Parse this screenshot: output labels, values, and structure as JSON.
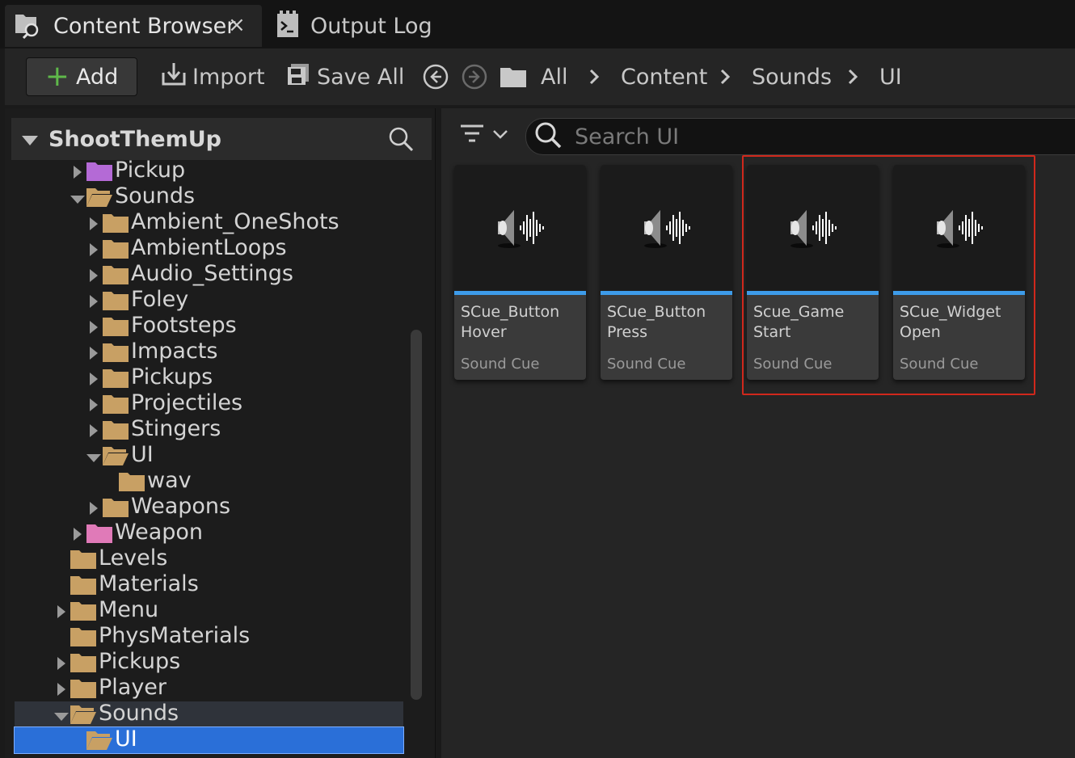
{
  "tabs": {
    "content_browser": "Content Browser",
    "close": "×",
    "output_log": "Output Log"
  },
  "toolbar": {
    "add": "Add",
    "import": "Import",
    "save_all": "Save All"
  },
  "breadcrumb": [
    "All",
    "Content",
    "Sounds",
    "UI"
  ],
  "tree": {
    "root": "ShootThemUp",
    "rows": [
      {
        "label": "Pickup",
        "indent": 4,
        "arrow": "right",
        "color": "#b46ad6",
        "open": false
      },
      {
        "label": "Sounds",
        "indent": 4,
        "arrow": "down",
        "color": "#c8a064",
        "open": true
      },
      {
        "label": "Ambient_OneShots",
        "indent": 5,
        "arrow": "right",
        "color": "#c8a064",
        "open": false
      },
      {
        "label": "AmbientLoops",
        "indent": 5,
        "arrow": "right",
        "color": "#c8a064",
        "open": false
      },
      {
        "label": "Audio_Settings",
        "indent": 5,
        "arrow": "right",
        "color": "#c8a064",
        "open": false
      },
      {
        "label": "Foley",
        "indent": 5,
        "arrow": "right",
        "color": "#c8a064",
        "open": false
      },
      {
        "label": "Footsteps",
        "indent": 5,
        "arrow": "right",
        "color": "#c8a064",
        "open": false
      },
      {
        "label": "Impacts",
        "indent": 5,
        "arrow": "right",
        "color": "#c8a064",
        "open": false
      },
      {
        "label": "Pickups",
        "indent": 5,
        "arrow": "right",
        "color": "#c8a064",
        "open": false
      },
      {
        "label": "Projectiles",
        "indent": 5,
        "arrow": "right",
        "color": "#c8a064",
        "open": false
      },
      {
        "label": "Stingers",
        "indent": 5,
        "arrow": "right",
        "color": "#c8a064",
        "open": false
      },
      {
        "label": "UI",
        "indent": 5,
        "arrow": "down",
        "color": "#c8a064",
        "open": true
      },
      {
        "label": "wav",
        "indent": 6,
        "arrow": "none",
        "color": "#c8a064",
        "open": false
      },
      {
        "label": "Weapons",
        "indent": 5,
        "arrow": "right",
        "color": "#c8a064",
        "open": false
      },
      {
        "label": "Weapon",
        "indent": 4,
        "arrow": "right",
        "color": "#e07ab8",
        "open": false
      },
      {
        "label": "Levels",
        "indent": 3,
        "arrow": "none",
        "color": "#c8a064",
        "open": false
      },
      {
        "label": "Materials",
        "indent": 3,
        "arrow": "none",
        "color": "#c8a064",
        "open": false
      },
      {
        "label": "Menu",
        "indent": 3,
        "arrow": "right",
        "color": "#c8a064",
        "open": false
      },
      {
        "label": "PhysMaterials",
        "indent": 3,
        "arrow": "none",
        "color": "#c8a064",
        "open": false
      },
      {
        "label": "Pickups",
        "indent": 3,
        "arrow": "right",
        "color": "#c8a064",
        "open": false
      },
      {
        "label": "Player",
        "indent": 3,
        "arrow": "right",
        "color": "#c8a064",
        "open": false
      },
      {
        "label": "Sounds",
        "indent": 3,
        "arrow": "down",
        "color": "#c8a064",
        "open": true,
        "state": "highlighted"
      },
      {
        "label": "UI",
        "indent": 4,
        "arrow": "none",
        "color": "#c8a064",
        "open": true,
        "state": "selected"
      }
    ]
  },
  "search": {
    "placeholder": "Search UI",
    "value": ""
  },
  "assets": [
    {
      "name": "SCue_Button Hover",
      "type": "Sound Cue"
    },
    {
      "name": "SCue_Button Press",
      "type": "Sound Cue"
    },
    {
      "name": "Scue_Game Start",
      "type": "Sound Cue"
    },
    {
      "name": "SCue_Widget Open",
      "type": "Sound Cue"
    }
  ],
  "colors": {
    "accent_blue": "#3d9be9",
    "selection": "#2a6fd8",
    "add_plus": "#5fb84a",
    "annotation_red": "#d0281c"
  }
}
